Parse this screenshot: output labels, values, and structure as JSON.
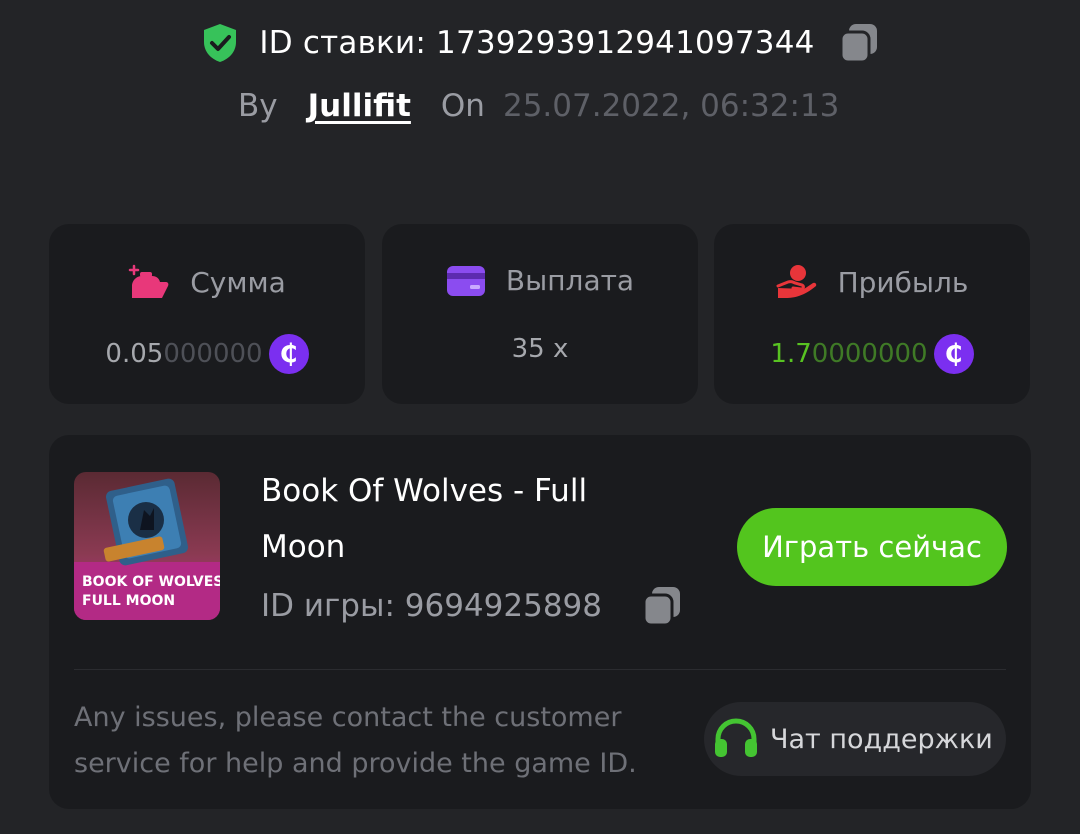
{
  "header": {
    "bet_id_label": "ID ставки: 1739293912941097344",
    "by_label": "By",
    "username": "Jullifit",
    "on_label": "On",
    "datetime": "25.07.2022, 06:32:13"
  },
  "stats": {
    "amount": {
      "label": "Сумма",
      "value_main": "0.05",
      "value_dim": "000000",
      "currency_symbol": "₵"
    },
    "payout": {
      "label": "Выплата",
      "value": "35 x"
    },
    "profit": {
      "label": "Прибыль",
      "value_main": "1.7",
      "value_dim": "0000000",
      "currency_symbol": "₵"
    }
  },
  "game": {
    "title": "Book Of Wolves - Full Moon",
    "thumb_line1": "BOOK OF WOLVES",
    "thumb_line2": "FULL MOON",
    "game_id_label": "ID игры: 9694925898",
    "play_button": "Играть сейчас",
    "help_text": "Any issues, please contact the customer service for help and provide the game ID.",
    "support_button": "Чат поддержки"
  },
  "colors": {
    "background": "#232427",
    "card": "#1a1b1e",
    "accent_green": "#53c51e",
    "coin_purple": "#7b2ff0",
    "amount_icon": "#e8387a",
    "payout_icon": "#8b4cf0",
    "profit_icon": "#e8353a"
  },
  "icons": {
    "verified": "shield-check-icon",
    "copy": "copy-icon",
    "amount": "money-bag-icon",
    "payout": "credit-card-icon",
    "profit": "hand-coin-icon",
    "support": "headset-icon"
  }
}
